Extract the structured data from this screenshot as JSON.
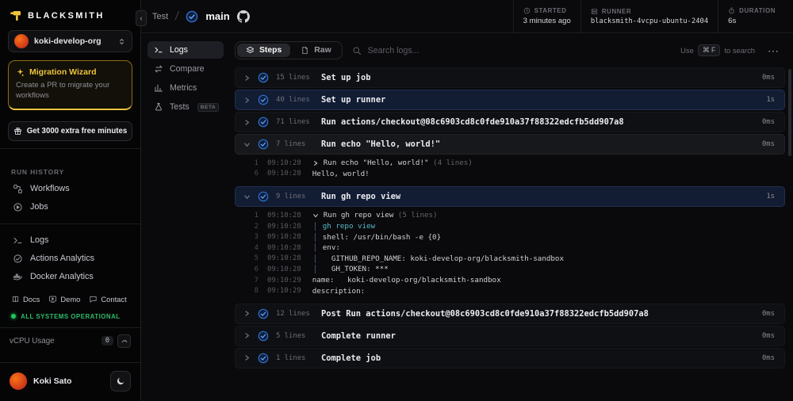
{
  "brand": {
    "name": "BLACKSMITH",
    "accent": "#eec43d"
  },
  "sidebar": {
    "org_name": "koki-develop-org",
    "migration": {
      "title": "Migration Wizard",
      "subtitle": "Create a PR to migrate your workflows"
    },
    "promo_label": "Get 3000 extra free minutes",
    "run_history_label": "RUN HISTORY",
    "run_history_items": [
      {
        "label": "Workflows"
      },
      {
        "label": "Jobs"
      }
    ],
    "nav_items": [
      {
        "label": "Logs"
      },
      {
        "label": "Actions Analytics"
      },
      {
        "label": "Docker Analytics"
      }
    ],
    "footer_links": [
      {
        "label": "Docs"
      },
      {
        "label": "Demo"
      },
      {
        "label": "Contact"
      }
    ],
    "status_text": "ALL SYSTEMS OPERATIONAL",
    "vcpu": {
      "label": "vCPU Usage",
      "value": "0"
    },
    "user_name": "Koki Sato"
  },
  "header": {
    "workflow_name": "Test",
    "branch": "main",
    "stats": [
      {
        "label": "STARTED",
        "value": "3 minutes ago"
      },
      {
        "label": "RUNNER",
        "value": "blacksmith-4vcpu-ubuntu-2404"
      },
      {
        "label": "DURATION",
        "value": "6s"
      }
    ]
  },
  "subnav": [
    {
      "label": "Logs",
      "active": true
    },
    {
      "label": "Compare",
      "active": false
    },
    {
      "label": "Metrics",
      "active": false
    },
    {
      "label": "Tests",
      "active": false,
      "badge": "BETA"
    }
  ],
  "toolbar": {
    "steps_tab": "Steps",
    "raw_tab": "Raw",
    "search_placeholder": "Search logs...",
    "hint_use": "Use",
    "hint_keys": "⌘ F",
    "hint_rest": "to search",
    "menu_label": "⋯"
  },
  "steps": [
    {
      "line_count": "15 lines",
      "name": "Set up job",
      "duration": "0ms"
    },
    {
      "line_count": "40 lines",
      "name": "Set up runner",
      "duration": "1s",
      "highlight": true
    },
    {
      "line_count": "71 lines",
      "name": "Run actions/checkout@08c6903cd8c0fde910a37f88322edcfb5dd907a8",
      "duration": "0ms"
    },
    {
      "line_count": "7 lines",
      "name": "Run echo \"Hello, world!\"",
      "duration": "0ms",
      "expanded": true,
      "log": [
        {
          "num": "1",
          "time": "09:10:28",
          "marker": "collapsed",
          "text": "Run echo \"Hello, world!\"",
          "suffix": "(4 lines)"
        },
        {
          "num": "6",
          "time": "09:10:28",
          "text": "Hello, world!"
        }
      ]
    },
    {
      "line_count": "9 lines",
      "name": "Run gh repo view",
      "duration": "1s",
      "expanded": true,
      "highlight": true,
      "log": [
        {
          "num": "1",
          "time": "09:10:28",
          "marker": "expanded",
          "text": "Run gh repo view",
          "suffix": "(5 lines)"
        },
        {
          "num": "2",
          "time": "09:10:28",
          "text": "gh repo view",
          "style": "command",
          "group": true
        },
        {
          "num": "3",
          "time": "09:10:28",
          "text": "shell: /usr/bin/bash -e {0}",
          "group": true
        },
        {
          "num": "4",
          "time": "09:10:28",
          "text": "env:",
          "group": true
        },
        {
          "num": "5",
          "time": "09:10:28",
          "text": "  GITHUB_REPO_NAME: koki-develop-org/blacksmith-sandbox",
          "group": true
        },
        {
          "num": "6",
          "time": "09:10:28",
          "text": "  GH_TOKEN: ***",
          "group": true
        },
        {
          "num": "7",
          "time": "09:10:29",
          "text": "name:   koki-develop-org/blacksmith-sandbox"
        },
        {
          "num": "8",
          "time": "09:10:29",
          "text": "description:"
        }
      ]
    },
    {
      "line_count": "12 lines",
      "name": "Post Run actions/checkout@08c6903cd8c0fde910a37f88322edcfb5dd907a8",
      "duration": "0ms"
    },
    {
      "line_count": "5 lines",
      "name": "Complete runner",
      "duration": "0ms"
    },
    {
      "line_count": "1 lines",
      "name": "Complete job",
      "duration": "0ms"
    }
  ]
}
